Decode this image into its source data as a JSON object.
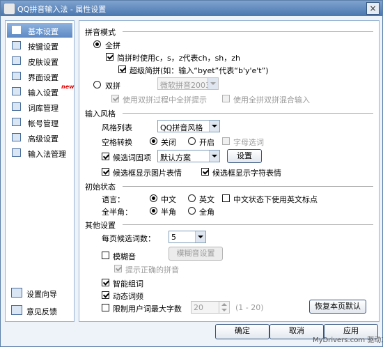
{
  "window": {
    "title": "QQ拼音输入法 - 属性设置"
  },
  "sidebar": {
    "items": [
      {
        "label": "基本设置",
        "icon": "wrench-icon",
        "active": true
      },
      {
        "label": "按键设置",
        "icon": "keyboard-icon"
      },
      {
        "label": "皮肤设置",
        "icon": "skin-icon"
      },
      {
        "label": "界面设置",
        "icon": "interface-icon"
      },
      {
        "label": "输入设置",
        "icon": "input-icon",
        "badge": "new"
      },
      {
        "label": "词库管理",
        "icon": "dictionary-icon"
      },
      {
        "label": "帐号管理",
        "icon": "account-icon"
      },
      {
        "label": "高级设置",
        "icon": "advanced-icon"
      },
      {
        "label": "输入法管理",
        "icon": "ime-manage-icon"
      }
    ],
    "bottom": [
      {
        "label": "设置向导",
        "icon": "wizard-icon"
      },
      {
        "label": "意见反馈",
        "icon": "feedback-icon"
      }
    ]
  },
  "pinyin_mode": {
    "section": "拼音模式",
    "full": "全拼",
    "shorthand": "简拼时使用c，s，z代表ch，sh，zh",
    "super_short": "超级简拼(如：输入“byet”代表“b'y'e't”)",
    "double": "双拼",
    "double_scheme": "微软拼音2003",
    "double_hint": "使用双拼过程中全拼提示",
    "mixed": "使用全拼双拼混合输入"
  },
  "input_style": {
    "section": "输入风格",
    "style_label": "风格列表",
    "style_value": "QQ拼音风格",
    "space_label": "空格转换",
    "off": "关闭",
    "on": "开启",
    "letter_select": "字母选词",
    "fixed_label": "候选词固项",
    "fixed_value": "默认方案",
    "setup": "设置",
    "show_images": "候选框显示图片表情",
    "show_chars": "候选框显示字符表情"
  },
  "initial_state": {
    "section": "初始状态",
    "lang_label": "语言：",
    "chinese": "中文",
    "english": "英文",
    "english_punct": "中文状态下使用英文标点",
    "width_label": "全半角：",
    "half": "半角",
    "full": "全角"
  },
  "other": {
    "section": "其他设置",
    "per_page_label": "每页候选词数：",
    "per_page_value": "5",
    "fuzzy": "模糊音",
    "fuzzy_btn": "模糊音设置",
    "correct_hint": "提示正确的拼音",
    "smart": "智能组词",
    "dynamic": "动态词频",
    "limit": "限制用户词最大字数",
    "limit_value": "20",
    "limit_range": "(1 - 20)",
    "restore": "恢复本页默认"
  },
  "footer": {
    "ok": "确定",
    "cancel": "取消",
    "apply": "应用"
  },
  "watermark": "MyDrivers.com 驱动之家"
}
